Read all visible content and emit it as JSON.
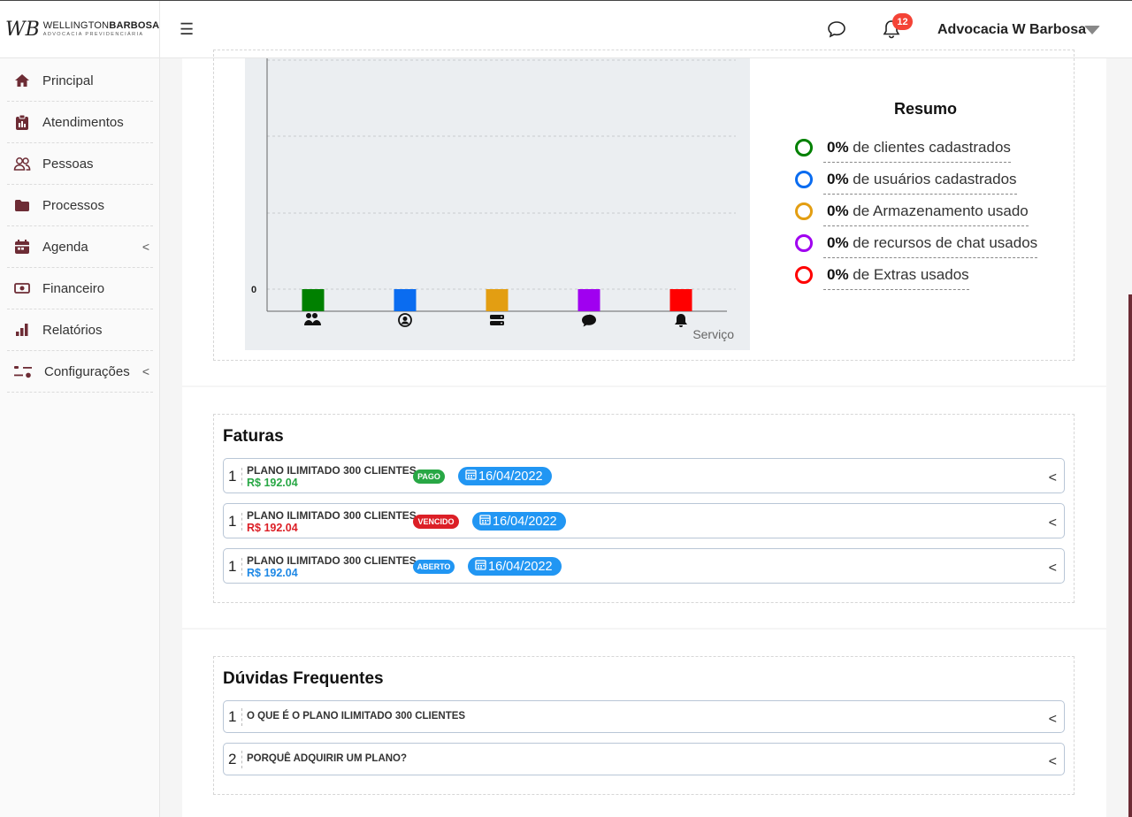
{
  "header": {
    "logo_mark": "WB",
    "logo_name_light": "WELLINGTON",
    "logo_name_bold": "BARBOSA",
    "logo_sub": "ADVOCACIA PREVIDENCIÁRIA",
    "notification_count": "12",
    "user_name": "Advocacia W Barbosa"
  },
  "sidebar": {
    "items": [
      {
        "label": "Principal",
        "icon": "home-icon"
      },
      {
        "label": "Atendimentos",
        "icon": "clipboard-icon"
      },
      {
        "label": "Pessoas",
        "icon": "users-icon"
      },
      {
        "label": "Processos",
        "icon": "folder-icon"
      },
      {
        "label": "Agenda",
        "icon": "calendar-icon",
        "has_submenu": true
      },
      {
        "label": "Financeiro",
        "icon": "money-icon"
      },
      {
        "label": "Relatórios",
        "icon": "bar-chart-icon"
      },
      {
        "label": "Configurações",
        "icon": "sliders-icon",
        "has_submenu": true
      }
    ],
    "accent_color": "#6d2c35"
  },
  "chart_data": {
    "type": "bar",
    "categories": [
      "clientes",
      "usuários",
      "armazenamento",
      "chat",
      "extras"
    ],
    "category_icons": [
      "users-icon",
      "user-circle-icon",
      "storage-icon",
      "chat-icon",
      "bell-icon"
    ],
    "values": [
      0,
      0,
      0,
      0,
      0
    ],
    "colors": [
      "#008000",
      "#0a6cf0",
      "#e39e12",
      "#a000f0",
      "#ff0000"
    ],
    "y_tick_labels": [
      "0"
    ],
    "xlabel": "Serviço",
    "grid": true
  },
  "resumo": {
    "title": "Resumo",
    "items": [
      {
        "percent": "0%",
        "text": " de clientes cadastrados",
        "color": "#008000"
      },
      {
        "percent": "0%",
        "text": " de usuários cadastrados",
        "color": "#0a6cf0"
      },
      {
        "percent": "0%",
        "text": " de Armazenamento usado",
        "color": "#e39e12"
      },
      {
        "percent": "0%",
        "text": " de recursos de chat usados",
        "color": "#a000f0"
      },
      {
        "percent": "0%",
        "text": " de Extras usados",
        "color": "#ff0000"
      }
    ]
  },
  "faturas": {
    "title": "Faturas",
    "rows": [
      {
        "num": "1",
        "title": "PLANO ILIMITADO 300 CLIENTES",
        "value": "R$ 192.04",
        "value_color": "#28a745",
        "status": "PAGO",
        "status_color": "#28a745",
        "date": "16/04/2022"
      },
      {
        "num": "1",
        "title": "PLANO ILIMITADO 300 CLIENTES",
        "value": "R$ 192.04",
        "value_color": "#dc1f26",
        "status": "VENCIDO",
        "status_color": "#dc1f26",
        "date": "16/04/2022"
      },
      {
        "num": "1",
        "title": "PLANO ILIMITADO 300 CLIENTES",
        "value": "R$ 192.04",
        "value_color": "#1e88e5",
        "status": "ABERTO",
        "status_color": "#2196f3",
        "date": "16/04/2022"
      }
    ]
  },
  "faq": {
    "title": "Dúvidas Frequentes",
    "rows": [
      {
        "num": "1",
        "question": "O QUE É O PLANO ILIMITADO 300 CLIENTES"
      },
      {
        "num": "2",
        "question": "PORQUÊ ADQUIRIR UM PLANO?"
      }
    ]
  }
}
